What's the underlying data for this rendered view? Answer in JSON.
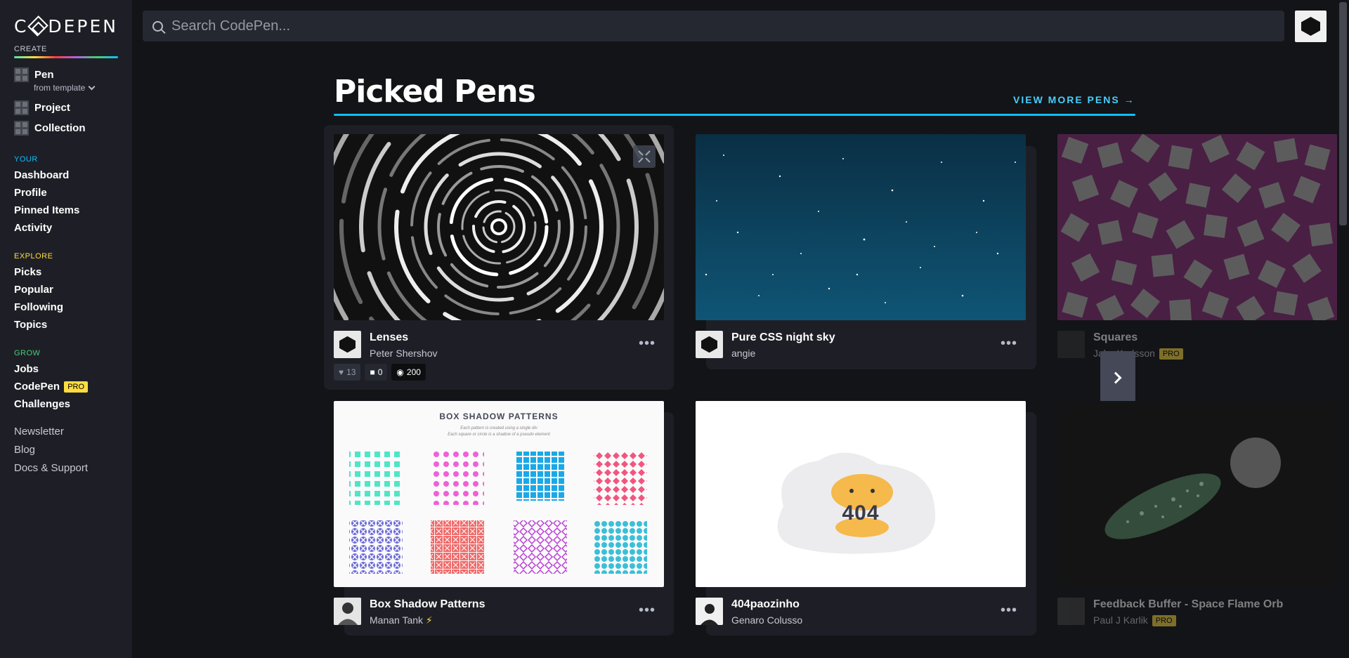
{
  "sidebar": {
    "logo": "CODEPEN",
    "create_label": "CREATE",
    "create_items": [
      {
        "label": "Pen",
        "sub": "from template"
      },
      {
        "label": "Project"
      },
      {
        "label": "Collection"
      }
    ],
    "your_label": "YOUR",
    "your_items": [
      "Dashboard",
      "Profile",
      "Pinned Items",
      "Activity"
    ],
    "explore_label": "EXPLORE",
    "explore_items": [
      "Picks",
      "Popular",
      "Following",
      "Topics"
    ],
    "grow_label": "GROW",
    "grow_items": [
      "Jobs",
      "CodePen",
      "Challenges"
    ],
    "pro_badge": "PRO",
    "extra_items": [
      "Newsletter",
      "Blog",
      "Docs & Support"
    ]
  },
  "search": {
    "placeholder": "Search CodePen..."
  },
  "main": {
    "title": "Picked Pens",
    "view_more": "VIEW MORE PENS"
  },
  "cards": [
    {
      "title": "Lenses",
      "user": "Peter Shershov",
      "likes": "13",
      "comments": "0",
      "views": "200"
    },
    {
      "title": "Pure CSS night sky",
      "user": "angie"
    },
    {
      "title": "Squares",
      "user": "Jake Karlsson",
      "badge": "PRO"
    },
    {
      "title": "Box Shadow Patterns",
      "user": "Manan Tank",
      "user_icon": "⚡",
      "thumb_title": "BOX SHADOW PATTERNS",
      "thumb_sub1": "Each pattern is created using a single div",
      "thumb_sub2": "Each square or circle is a shadow of a pseudo element"
    },
    {
      "title": "404paozinho",
      "user": "Genaro Colusso",
      "thumb_text": "404"
    },
    {
      "title": "Feedback Buffer - Space Flame Orb",
      "user": "Paul J Karlik",
      "badge": "PRO"
    }
  ],
  "menu_dots": "•••",
  "colors": {
    "accent_blue": "#0ebeff",
    "pro_yellow": "#ffdd40",
    "sidebar_bg": "#1e1f26",
    "page_bg": "#131417"
  }
}
